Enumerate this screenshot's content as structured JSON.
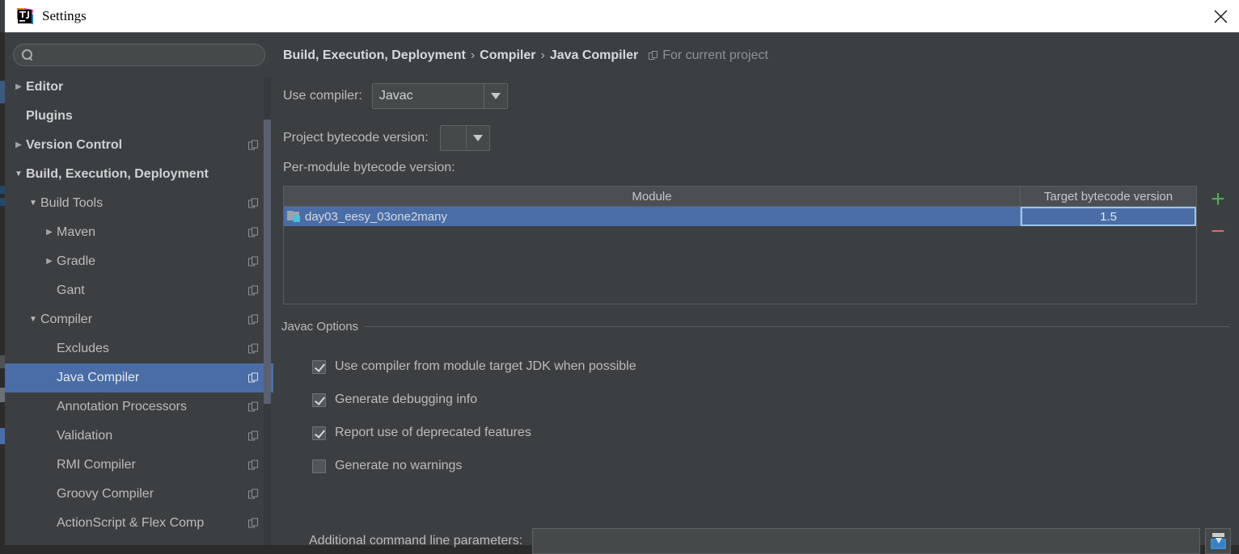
{
  "window": {
    "title": "Settings",
    "logo_icon": "intellij-idea-logo",
    "close_icon": "close-icon"
  },
  "sidebar": {
    "search": {
      "value": "",
      "placeholder": "",
      "icon": "search-icon"
    },
    "items": [
      {
        "label": "Editor",
        "level": 0,
        "arrow": "right",
        "bold": true,
        "copy": false,
        "selected": false
      },
      {
        "label": "Plugins",
        "level": 0,
        "arrow": "none",
        "bold": true,
        "copy": false,
        "selected": false
      },
      {
        "label": "Version Control",
        "level": 0,
        "arrow": "right",
        "bold": true,
        "copy": true,
        "selected": false
      },
      {
        "label": "Build, Execution, Deployment",
        "level": 0,
        "arrow": "down",
        "bold": true,
        "copy": false,
        "selected": false
      },
      {
        "label": "Build Tools",
        "level": 1,
        "arrow": "down",
        "bold": false,
        "copy": true,
        "selected": false
      },
      {
        "label": "Maven",
        "level": 2,
        "arrow": "right",
        "bold": false,
        "copy": true,
        "selected": false
      },
      {
        "label": "Gradle",
        "level": 2,
        "arrow": "right",
        "bold": false,
        "copy": true,
        "selected": false
      },
      {
        "label": "Gant",
        "level": 2,
        "arrow": "none",
        "bold": false,
        "copy": true,
        "selected": false
      },
      {
        "label": "Compiler",
        "level": 1,
        "arrow": "down",
        "bold": false,
        "copy": true,
        "selected": false
      },
      {
        "label": "Excludes",
        "level": 2,
        "arrow": "none",
        "bold": false,
        "copy": true,
        "selected": false
      },
      {
        "label": "Java Compiler",
        "level": 2,
        "arrow": "none",
        "bold": false,
        "copy": true,
        "selected": true
      },
      {
        "label": "Annotation Processors",
        "level": 2,
        "arrow": "none",
        "bold": false,
        "copy": true,
        "selected": false
      },
      {
        "label": "Validation",
        "level": 2,
        "arrow": "none",
        "bold": false,
        "copy": true,
        "selected": false
      },
      {
        "label": "RMI Compiler",
        "level": 2,
        "arrow": "none",
        "bold": false,
        "copy": true,
        "selected": false
      },
      {
        "label": "Groovy Compiler",
        "level": 2,
        "arrow": "none",
        "bold": false,
        "copy": true,
        "selected": false
      },
      {
        "label": "ActionScript & Flex Comp",
        "level": 2,
        "arrow": "none",
        "bold": false,
        "copy": true,
        "selected": false
      }
    ]
  },
  "breadcrumb": {
    "crumbs": [
      "Build, Execution, Deployment",
      "Compiler",
      "Java Compiler"
    ],
    "separator": "›",
    "scope_icon": "copy-icon",
    "scope_text": "For current project"
  },
  "form": {
    "use_compiler_label": "Use compiler:",
    "use_compiler_value": "Javac",
    "project_bytecode_label": "Project bytecode version:",
    "project_bytecode_value": "",
    "per_module_label": "Per-module bytecode version:"
  },
  "table": {
    "columns": [
      "Module",
      "Target bytecode version"
    ],
    "rows": [
      {
        "module": "day03_eesy_03one2many",
        "target": "1.5",
        "icon": "module-icon",
        "selected": true
      }
    ],
    "add_button": "+",
    "remove_button": "−"
  },
  "javac_options": {
    "group_title": "Javac Options",
    "checkboxes": [
      {
        "label": "Use compiler from module target JDK when possible",
        "checked": true
      },
      {
        "label": "Generate debugging info",
        "checked": true
      },
      {
        "label": "Report use of deprecated features",
        "checked": true
      },
      {
        "label": "Generate no warnings",
        "checked": false
      }
    ],
    "params_label": "Additional command line parameters:",
    "params_value": "",
    "params_placeholder": "",
    "expand_icon": "insert-into-field-icon"
  },
  "annotation": {
    "arrow_icon": "red-pointer-arrow",
    "color": "#f4372e"
  },
  "colors": {
    "panel_bg": "#3c3f41",
    "titlebar_bg": "#ffffff",
    "selection_blue": "#4a6da7",
    "text": "#bbbbbb",
    "accent_green": "#4caf50",
    "accent_red": "#e06c5e"
  }
}
